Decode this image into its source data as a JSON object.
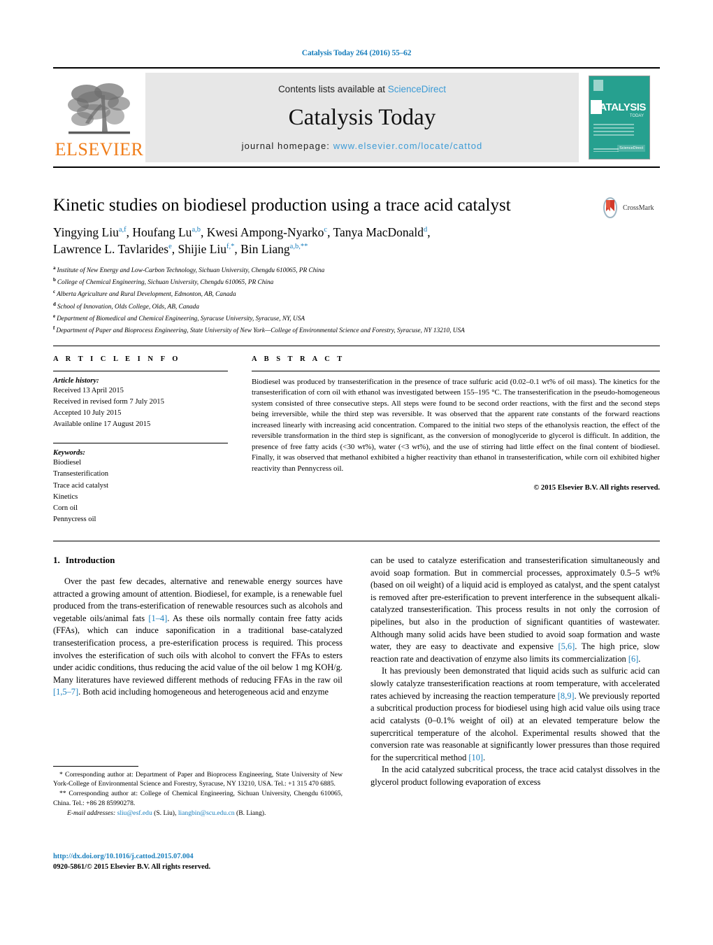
{
  "running_head": "Catalysis Today 264 (2016) 55–62",
  "masthead": {
    "publisher_name": "ELSEVIER",
    "contents_prefix": "Contents lists available at ",
    "contents_link": "ScienceDirect",
    "journal_name": "Catalysis Today",
    "homepage_prefix": "journal homepage: ",
    "homepage_url": "www.elsevier.com/locate/cattod",
    "cover": {
      "title": "CATALYSIS",
      "subtitle": "TODAY",
      "sciencedirect_badge": "ScienceDirect"
    },
    "link_color": "#3c9bd6"
  },
  "article": {
    "title": "Kinetic studies on biodiesel production using a trace acid catalyst",
    "crossmark_label": "CrossMark",
    "authors_line1": "Yingying Liu<sup>a,f</sup>, Houfang Lu<sup>a,b</sup>, Kwesi Ampong-Nyarko<sup>c</sup>, Tanya MacDonald<sup>d</sup>,",
    "authors_line2": "Lawrence L. Tavlarides<sup>e</sup>, Shijie Liu<sup>f,*</sup>, Bin Liang<sup>a,b,**</sup>",
    "affiliations": [
      {
        "mark": "a",
        "text": "Institute of New Energy and Low-Carbon Technology, Sichuan University, Chengdu 610065, PR China"
      },
      {
        "mark": "b",
        "text": "College of Chemical Engineering, Sichuan University, Chengdu 610065, PR China"
      },
      {
        "mark": "c",
        "text": "Alberta Agriculture and Rural Development, Edmonton, AB, Canada"
      },
      {
        "mark": "d",
        "text": "School of Innovation, Olds College, Olds, AB, Canada"
      },
      {
        "mark": "e",
        "text": "Department of Biomedical and Chemical Engineering, Syracuse University, Syracuse, NY, USA"
      },
      {
        "mark": "f",
        "text": "Department of Paper and Bioprocess Engineering, State University of New York—College of Environmental Science and Forestry, Syracuse, NY 13210, USA"
      }
    ]
  },
  "article_info": {
    "heading": "A R T I C L E    I N F O",
    "history_label": "Article history:",
    "history": [
      "Received 13 April 2015",
      "Received in revised form 7 July 2015",
      "Accepted 10 July 2015",
      "Available online 17 August 2015"
    ],
    "keywords_label": "Keywords:",
    "keywords": [
      "Biodiesel",
      "Transesterification",
      "Trace acid catalyst",
      "Kinetics",
      "Corn oil",
      "Pennycress oil"
    ]
  },
  "abstract": {
    "heading": "A B S T R A C T",
    "text": "Biodiesel was produced by transesterification in the presence of trace sulfuric acid (0.02–0.1 wt% of oil mass). The kinetics for the transesterification of corn oil with ethanol was investigated between 155–195 °C. The transesterification in the pseudo-homogeneous system consisted of three consecutive steps. All steps were found to be second order reactions, with the first and the second steps being irreversible, while the third step was reversible. It was observed that the apparent rate constants of the forward reactions increased linearly with increasing acid concentration. Compared to the initial two steps of the ethanolysis reaction, the effect of the reversible transformation in the third step is significant, as the conversion of monoglyceride to glycerol is difficult. In addition, the presence of free fatty acids (<30 wt%), water (<3 wt%), and the use of stirring had little effect on the final content of biodiesel. Finally, it was observed that methanol exhibited a higher reactivity than ethanol in transesterification, while corn oil exhibited higher reactivity than Pennycress oil.",
    "copyright": "© 2015 Elsevier B.V. All rights reserved."
  },
  "body": {
    "section_number": "1.",
    "section_title": "Introduction",
    "left_paragraphs": [
      "Over the past few decades, alternative and renewable energy sources have attracted a growing amount of attention. Biodiesel, for example, is a renewable fuel produced from the trans-esterification of renewable resources such as alcohols and vegetable oils/animal fats [1–4]. As these oils normally contain free fatty acids (FFAs), which can induce saponification in a traditional base-catalyzed transesterification process, a pre-esterification process is required. This process involves the esterification of such oils with alcohol to convert the FFAs to esters under acidic conditions, thus reducing the acid value of the oil below 1 mg KOH/g. Many literatures have reviewed different methods of reducing FFAs in the raw oil [1,5–7]. Both acid including homogeneous and heterogeneous acid and enzyme"
    ],
    "right_paragraphs": [
      "can be used to catalyze esterification and transesterification simultaneously and avoid soap formation. But in commercial processes, approximately 0.5–5 wt% (based on oil weight) of a liquid acid is employed as catalyst, and the spent catalyst is removed after pre-esterification to prevent interference in the subsequent alkali-catalyzed transesterification. This process results in not only the corrosion of pipelines, but also in the production of significant quantities of wastewater. Although many solid acids have been studied to avoid soap formation and waste water, they are easy to deactivate and expensive [5,6]. The high price, slow reaction rate and deactivation of enzyme also limits its commercialization [6].",
      "It has previously been demonstrated that liquid acids such as sulfuric acid can slowly catalyze transesterification reactions at room temperature, with accelerated rates achieved by increasing the reaction temperature [8,9]. We previously reported a subcritical production process for biodiesel using high acid value oils using trace acid catalysts (0–0.1% weight of oil) at an elevated temperature below the supercritical temperature of the alcohol. Experimental results showed that the conversion rate was reasonable at significantly lower pressures than those required for the supercritical method [10].",
      "In the acid catalyzed subcritical process, the trace acid catalyst dissolves in the glycerol product following evaporation of excess"
    ],
    "reference_color": "#1a7fbd"
  },
  "footnotes": {
    "corresponding1": "* Corresponding author at: Department of Paper and Bioprocess Engineering, State University of New York-College of Environmental Science and Forestry, Syracuse, NY 13210, USA. Tel.: +1 315 470 6885.",
    "corresponding2": "** Corresponding author at: College of Chemical Engineering, Sichuan University, Chengdu 610065, China. Tel.: +86 28 85990278.",
    "email_label": "E-mail addresses:",
    "email1": "sliu@esf.edu",
    "email1_owner": "(S. Liu),",
    "email2": "liangbin@scu.edu.cn",
    "email2_owner": "(B. Liang).",
    "doi_url": "http://dx.doi.org/10.1016/j.cattod.2015.07.004",
    "issn_line": "0920-5861/© 2015 Elsevier B.V. All rights reserved."
  }
}
